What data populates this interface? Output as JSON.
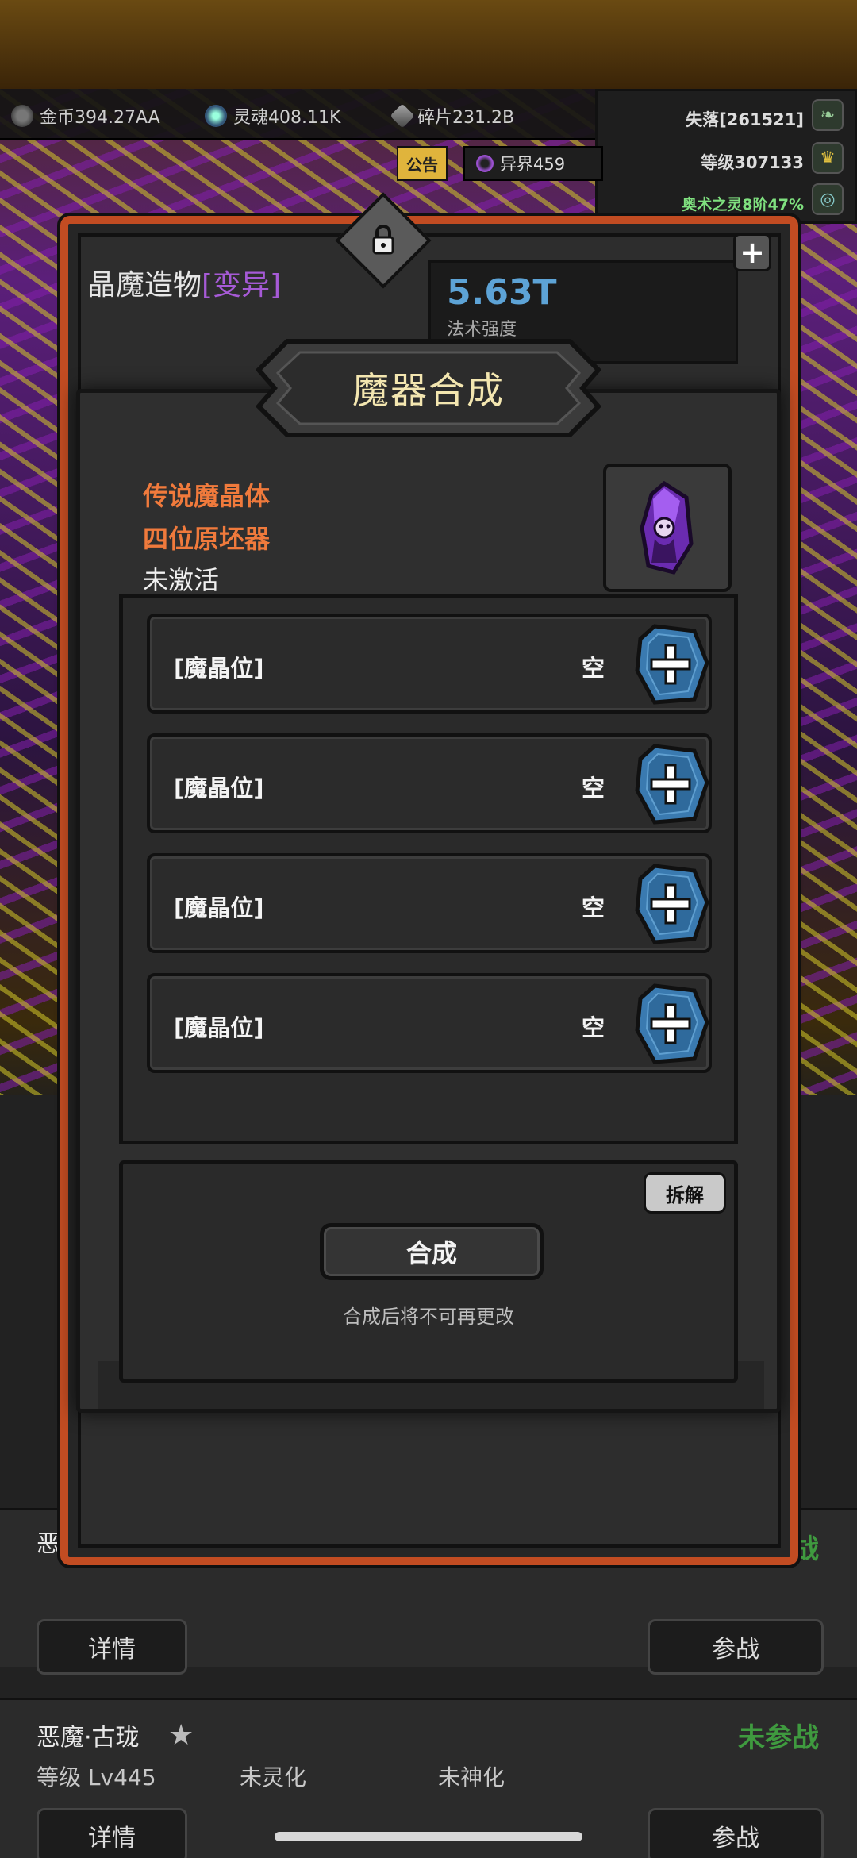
{
  "resources": {
    "gold": "金币394.27AA",
    "soul": "灵魂408.11K",
    "shard": "碎片231.2B"
  },
  "right_panel": {
    "lost": "失落[261521]",
    "level": "等级307133",
    "arcane": "奥术之灵8阶47%"
  },
  "notice_label": "公告",
  "realm_label": "异界459",
  "hero": {
    "name": "晶魔造物",
    "variant": "[变异]",
    "stat_value": "5.63T",
    "stat_label": "法术强度"
  },
  "modal": {
    "title": "魔器合成",
    "info_line1": "传说魔晶体",
    "info_line2": "四位原坯器",
    "info_line3": "未激活",
    "slots": [
      {
        "label": "[魔晶位]",
        "status": "空"
      },
      {
        "label": "[魔晶位]",
        "status": "空"
      },
      {
        "label": "[魔晶位]",
        "status": "空"
      },
      {
        "label": "[魔晶位]",
        "status": "空"
      }
    ],
    "dismantle_label": "拆解",
    "synth_label": "合成",
    "synth_note": "合成后将不可再更改"
  },
  "cards": [
    {
      "name": "恶",
      "status": "战",
      "detail_label": "详情",
      "join_label": "参战"
    },
    {
      "name": "恶魔·古珑",
      "level": "等级 Lv445",
      "spirit": "未灵化",
      "divine": "未神化",
      "status": "未参战",
      "detail_label": "详情",
      "join_label": "参战"
    }
  ],
  "colors": {
    "accent_orange": "#f07a3c",
    "frame_orange": "#c24c22",
    "stat_blue": "#5da3d6",
    "variant_purple": "#a65ad6",
    "status_green": "#3f9a3f"
  }
}
